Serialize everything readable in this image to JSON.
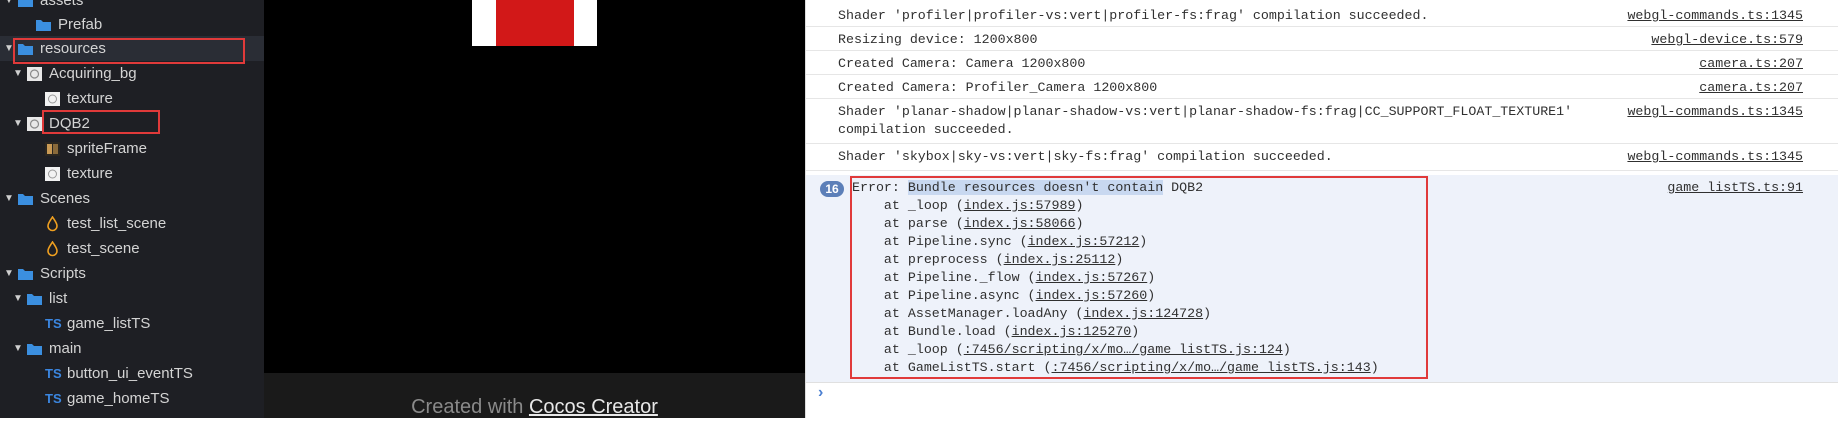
{
  "tree": {
    "items": [
      {
        "label": "assets",
        "arrow": "▼",
        "icon": "folder-icon"
      },
      {
        "label": "Prefab",
        "arrow": "",
        "icon": "folder-icon"
      },
      {
        "label": "resources",
        "arrow": "▼",
        "icon": "folder-icon"
      },
      {
        "label": "Acquiring_bg",
        "arrow": "▼",
        "icon": "image-icon"
      },
      {
        "label": "texture",
        "arrow": "",
        "icon": "texture-icon"
      },
      {
        "label": "DQB2",
        "arrow": "▼",
        "icon": "image-icon"
      },
      {
        "label": "spriteFrame",
        "arrow": "",
        "icon": "sprite-icon"
      },
      {
        "label": "texture",
        "arrow": "",
        "icon": "texture-icon"
      },
      {
        "label": "Scenes",
        "arrow": "▼",
        "icon": "folder-icon"
      },
      {
        "label": "test_list_scene",
        "arrow": "",
        "icon": "scene-icon"
      },
      {
        "label": "test_scene",
        "arrow": "",
        "icon": "scene-icon"
      },
      {
        "label": "Scripts",
        "arrow": "▼",
        "icon": "folder-icon"
      },
      {
        "label": "list",
        "arrow": "▼",
        "icon": "folder-icon"
      },
      {
        "label": "game_listTS",
        "arrow": "",
        "icon": "ts-icon",
        "badge": "TS"
      },
      {
        "label": "main",
        "arrow": "▼",
        "icon": "folder-icon"
      },
      {
        "label": "button_ui_eventTS",
        "arrow": "",
        "icon": "ts-icon",
        "badge": "TS"
      },
      {
        "label": "game_homeTS",
        "arrow": "",
        "icon": "ts-icon",
        "badge": "TS"
      }
    ]
  },
  "game": {
    "footer_prefix": "Created with ",
    "footer_link": "Cocos Creator"
  },
  "console": {
    "rows": [
      {
        "msg": "Shader 'profiler|profiler-vs:vert|profiler-fs:frag' compilation succeeded.",
        "src": "webgl-commands.ts:1345"
      },
      {
        "msg": "Resizing device: 1200x800",
        "src": "webgl-device.ts:579"
      },
      {
        "msg": "Created Camera: Camera 1200x800",
        "src": "camera.ts:207"
      },
      {
        "msg": "Created Camera: Profiler_Camera 1200x800",
        "src": "camera.ts:207"
      },
      {
        "msg": "Shader 'planar-shadow|planar-shadow-vs:vert|planar-shadow-fs:frag|CC_SUPPORT_FLOAT_TEXTURE1'\ncompilation succeeded.",
        "src": "webgl-commands.ts:1345"
      },
      {
        "msg": "Shader 'skybox|sky-vs:vert|sky-fs:frag' compilation succeeded.",
        "src": "webgl-commands.ts:1345"
      }
    ],
    "error": {
      "count": "16",
      "prefix": "Error: ",
      "selected": "Bundle resources doesn't contain",
      "suffix": " DQB2",
      "src": "game_listTS.ts:91",
      "stack": [
        {
          "fn": "    at _loop (",
          "link": "index.js:57989",
          "end": ")"
        },
        {
          "fn": "    at parse (",
          "link": "index.js:58066",
          "end": ")"
        },
        {
          "fn": "    at Pipeline.sync (",
          "link": "index.js:57212",
          "end": ")"
        },
        {
          "fn": "    at preprocess (",
          "link": "index.js:25112",
          "end": ")"
        },
        {
          "fn": "    at Pipeline._flow (",
          "link": "index.js:57267",
          "end": ")"
        },
        {
          "fn": "    at Pipeline.async (",
          "link": "index.js:57260",
          "end": ")"
        },
        {
          "fn": "    at AssetManager.loadAny (",
          "link": "index.js:124728",
          "end": ")"
        },
        {
          "fn": "    at Bundle.load (",
          "link": "index.js:125270",
          "end": ")"
        },
        {
          "fn": "    at _loop (",
          "link": ":7456/scripting/x/mo…/game_listTS.js:124",
          "end": ")"
        },
        {
          "fn": "    at GameListTS.start (",
          "link": ":7456/scripting/x/mo…/game_listTS.js:143",
          "end": ")"
        }
      ]
    },
    "prompt": "›"
  }
}
